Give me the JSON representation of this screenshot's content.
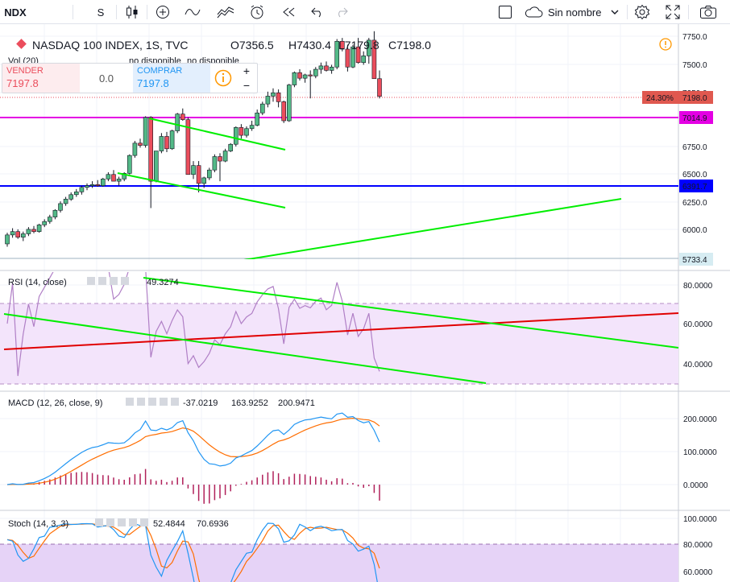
{
  "toolbar": {
    "symbol": "NDX",
    "interval": "S",
    "layout_name": "Sin nombre",
    "icons": [
      "candles-icon",
      "plus-circle-icon",
      "indicators-icon",
      "templates-icon",
      "alert-clock-icon",
      "replay-icon",
      "undo-icon",
      "redo-icon",
      "layout-square-icon",
      "cloud-icon",
      "chevron-down-icon",
      "gear-icon",
      "fullscreen-icon",
      "camera-icon"
    ]
  },
  "legend": {
    "title": "NASDAQ 100 INDEX, 1S, TVC",
    "open": "O7356.5",
    "high": "H7430.4",
    "low": "L7179.8",
    "close": "C7198.0",
    "vol_label": "Vol (20)",
    "no_disponible_1": "no disponible",
    "no_disponible_2": "no disponible"
  },
  "trade": {
    "sell_label": "VENDER",
    "sell_price": "7197.8",
    "spread": "0.0",
    "buy_label": "COMPRAR",
    "buy_price": "7197.8"
  },
  "price_axis": {
    "ticks": [
      "7750.0",
      "7500.0",
      "7250.0",
      "6750.0",
      "6500.0",
      "6250.0",
      "6000.0"
    ],
    "current_pct": "24.30%",
    "current_price": "7198.0",
    "magenta_level": "7014.9",
    "blue_level": "6391.7",
    "bottom_level": "5733.4"
  },
  "rsi": {
    "label": "RSI (14, close)",
    "value": "49.3274",
    "ticks": [
      "80.0000",
      "60.0000",
      "40.0000"
    ]
  },
  "macd": {
    "label": "MACD (12, 26, close, 9)",
    "hist": "-37.0219",
    "macd": "163.9252",
    "signal": "200.9471",
    "ticks": [
      "200.0000",
      "100.0000",
      "0.0000"
    ]
  },
  "stoch": {
    "label": "Stoch (14, 3, 3)",
    "k": "52.4844",
    "d": "70.6936",
    "ticks": [
      "100.0000",
      "80.0000",
      "60.0000"
    ]
  },
  "colors": {
    "up": "#53b987",
    "down": "#eb4d5c",
    "magenta": "#e400e4",
    "blue": "#0000ff",
    "green_line": "#00ee00",
    "red_line": "#e00000",
    "rsi": "#b07fc6",
    "macd_blue": "#2196f3",
    "macd_orange": "#ff6d00",
    "hist": "#b0205a"
  },
  "chart_data": {
    "type": "candlestick",
    "title": "NASDAQ 100 INDEX, 1S, TVC",
    "y_range": [
      5700,
      7800
    ],
    "candles": [
      [
        5880,
        5980,
        5855,
        5960
      ],
      [
        5960,
        6020,
        5935,
        5990
      ],
      [
        5990,
        6010,
        5925,
        5940
      ],
      [
        5940,
        5990,
        5905,
        5970
      ],
      [
        5970,
        6030,
        5950,
        6010
      ],
      [
        6010,
        6040,
        5975,
        5990
      ],
      [
        5990,
        6060,
        5980,
        6050
      ],
      [
        6050,
        6100,
        6030,
        6080
      ],
      [
        6080,
        6140,
        6060,
        6120
      ],
      [
        6120,
        6190,
        6100,
        6180
      ],
      [
        6180,
        6260,
        6160,
        6240
      ],
      [
        6240,
        6300,
        6220,
        6280
      ],
      [
        6280,
        6340,
        6265,
        6320
      ],
      [
        6320,
        6370,
        6300,
        6345
      ],
      [
        6345,
        6400,
        6320,
        6385
      ],
      [
        6385,
        6420,
        6360,
        6400
      ],
      [
        6400,
        6440,
        6380,
        6410
      ],
      [
        6410,
        6450,
        6390,
        6400
      ],
      [
        6400,
        6470,
        6390,
        6460
      ],
      [
        6460,
        6520,
        6440,
        6500
      ],
      [
        6500,
        6540,
        6470,
        6440
      ],
      [
        6440,
        6480,
        6400,
        6460
      ],
      [
        6460,
        6520,
        6440,
        6510
      ],
      [
        6510,
        6680,
        6500,
        6670
      ],
      [
        6670,
        6800,
        6650,
        6780
      ],
      [
        6780,
        6820,
        6740,
        6760
      ],
      [
        6760,
        7020,
        6740,
        7010
      ],
      [
        7010,
        7020,
        6200,
        6440
      ],
      [
        6440,
        6560,
        6430,
        6710
      ],
      [
        6710,
        6870,
        6690,
        6840
      ],
      [
        6840,
        6880,
        6700,
        6730
      ],
      [
        6730,
        6900,
        6720,
        6890
      ],
      [
        6890,
        7050,
        6870,
        7040
      ],
      [
        7040,
        7090,
        6980,
        6990
      ],
      [
        6990,
        7010,
        6520,
        6500
      ],
      [
        6500,
        6620,
        6460,
        6580
      ],
      [
        6580,
        6620,
        6340,
        6420
      ],
      [
        6420,
        6480,
        6380,
        6470
      ],
      [
        6470,
        6560,
        6450,
        6540
      ],
      [
        6540,
        6680,
        6520,
        6660
      ],
      [
        6660,
        6690,
        6440,
        6620
      ],
      [
        6620,
        6730,
        6610,
        6710
      ],
      [
        6710,
        6780,
        6700,
        6770
      ],
      [
        6770,
        6930,
        6750,
        6920
      ],
      [
        6920,
        6950,
        6820,
        6850
      ],
      [
        6850,
        6930,
        6830,
        6910
      ],
      [
        6910,
        6980,
        6890,
        6940
      ],
      [
        6940,
        7080,
        6930,
        7050
      ],
      [
        7050,
        7150,
        7030,
        7130
      ],
      [
        7130,
        7240,
        7100,
        7200
      ],
      [
        7200,
        7270,
        7150,
        7230
      ],
      [
        7230,
        7260,
        7100,
        7150
      ],
      [
        7150,
        7160,
        6960,
        6980
      ],
      [
        6980,
        7310,
        6970,
        7300
      ],
      [
        7300,
        7420,
        7280,
        7410
      ],
      [
        7410,
        7440,
        7340,
        7360
      ],
      [
        7360,
        7400,
        7320,
        7390
      ],
      [
        7390,
        7430,
        7180,
        7380
      ],
      [
        7380,
        7460,
        7360,
        7440
      ],
      [
        7440,
        7500,
        7400,
        7470
      ],
      [
        7470,
        7510,
        7420,
        7430
      ],
      [
        7430,
        7480,
        7400,
        7460
      ],
      [
        7460,
        7710,
        7440,
        7690
      ],
      [
        7690,
        7720,
        7600,
        7620
      ],
      [
        7620,
        7660,
        7420,
        7460
      ],
      [
        7460,
        7660,
        7450,
        7640
      ],
      [
        7640,
        7720,
        7490,
        7500
      ],
      [
        7500,
        7600,
        7480,
        7560
      ],
      [
        7560,
        7720,
        7490,
        7700
      ],
      [
        7700,
        7780,
        7380,
        7356
      ],
      [
        7356,
        7430,
        7180,
        7198
      ]
    ]
  }
}
